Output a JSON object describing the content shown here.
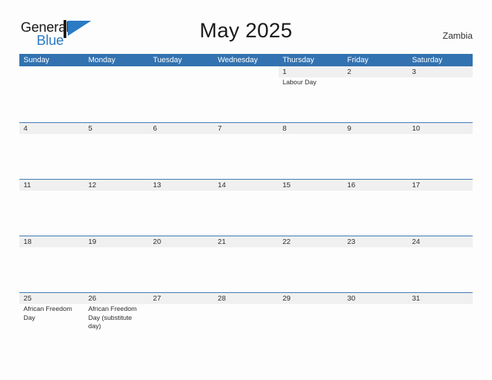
{
  "brand": {
    "name_part1": "General",
    "name_part2": "Blue",
    "mark": "triangle-logo",
    "accent_color": "#2a7ac4"
  },
  "header": {
    "title": "May 2025",
    "region": "Zambia"
  },
  "theme": {
    "header_blue": "#3272b0",
    "band_gray": "#f0f0f0",
    "page_background": "#fdfdfd",
    "text_color": "#2b2b2b"
  },
  "calendar": {
    "month": "May",
    "year": "2025",
    "weekdays": [
      "Sunday",
      "Monday",
      "Tuesday",
      "Wednesday",
      "Thursday",
      "Friday",
      "Saturday"
    ],
    "weeks": [
      {
        "days": [
          {
            "date": "",
            "events": []
          },
          {
            "date": "",
            "events": []
          },
          {
            "date": "",
            "events": []
          },
          {
            "date": "",
            "events": []
          },
          {
            "date": "1",
            "events": [
              "Labour Day"
            ]
          },
          {
            "date": "2",
            "events": []
          },
          {
            "date": "3",
            "events": []
          }
        ]
      },
      {
        "days": [
          {
            "date": "4",
            "events": []
          },
          {
            "date": "5",
            "events": []
          },
          {
            "date": "6",
            "events": []
          },
          {
            "date": "7",
            "events": []
          },
          {
            "date": "8",
            "events": []
          },
          {
            "date": "9",
            "events": []
          },
          {
            "date": "10",
            "events": []
          }
        ]
      },
      {
        "days": [
          {
            "date": "11",
            "events": []
          },
          {
            "date": "12",
            "events": []
          },
          {
            "date": "13",
            "events": []
          },
          {
            "date": "14",
            "events": []
          },
          {
            "date": "15",
            "events": []
          },
          {
            "date": "16",
            "events": []
          },
          {
            "date": "17",
            "events": []
          }
        ]
      },
      {
        "days": [
          {
            "date": "18",
            "events": []
          },
          {
            "date": "19",
            "events": []
          },
          {
            "date": "20",
            "events": []
          },
          {
            "date": "21",
            "events": []
          },
          {
            "date": "22",
            "events": []
          },
          {
            "date": "23",
            "events": []
          },
          {
            "date": "24",
            "events": []
          }
        ]
      },
      {
        "days": [
          {
            "date": "25",
            "events": [
              "African Freedom Day"
            ]
          },
          {
            "date": "26",
            "events": [
              "African Freedom Day (substitute day)"
            ]
          },
          {
            "date": "27",
            "events": []
          },
          {
            "date": "28",
            "events": []
          },
          {
            "date": "29",
            "events": []
          },
          {
            "date": "30",
            "events": []
          },
          {
            "date": "31",
            "events": []
          }
        ]
      }
    ]
  }
}
